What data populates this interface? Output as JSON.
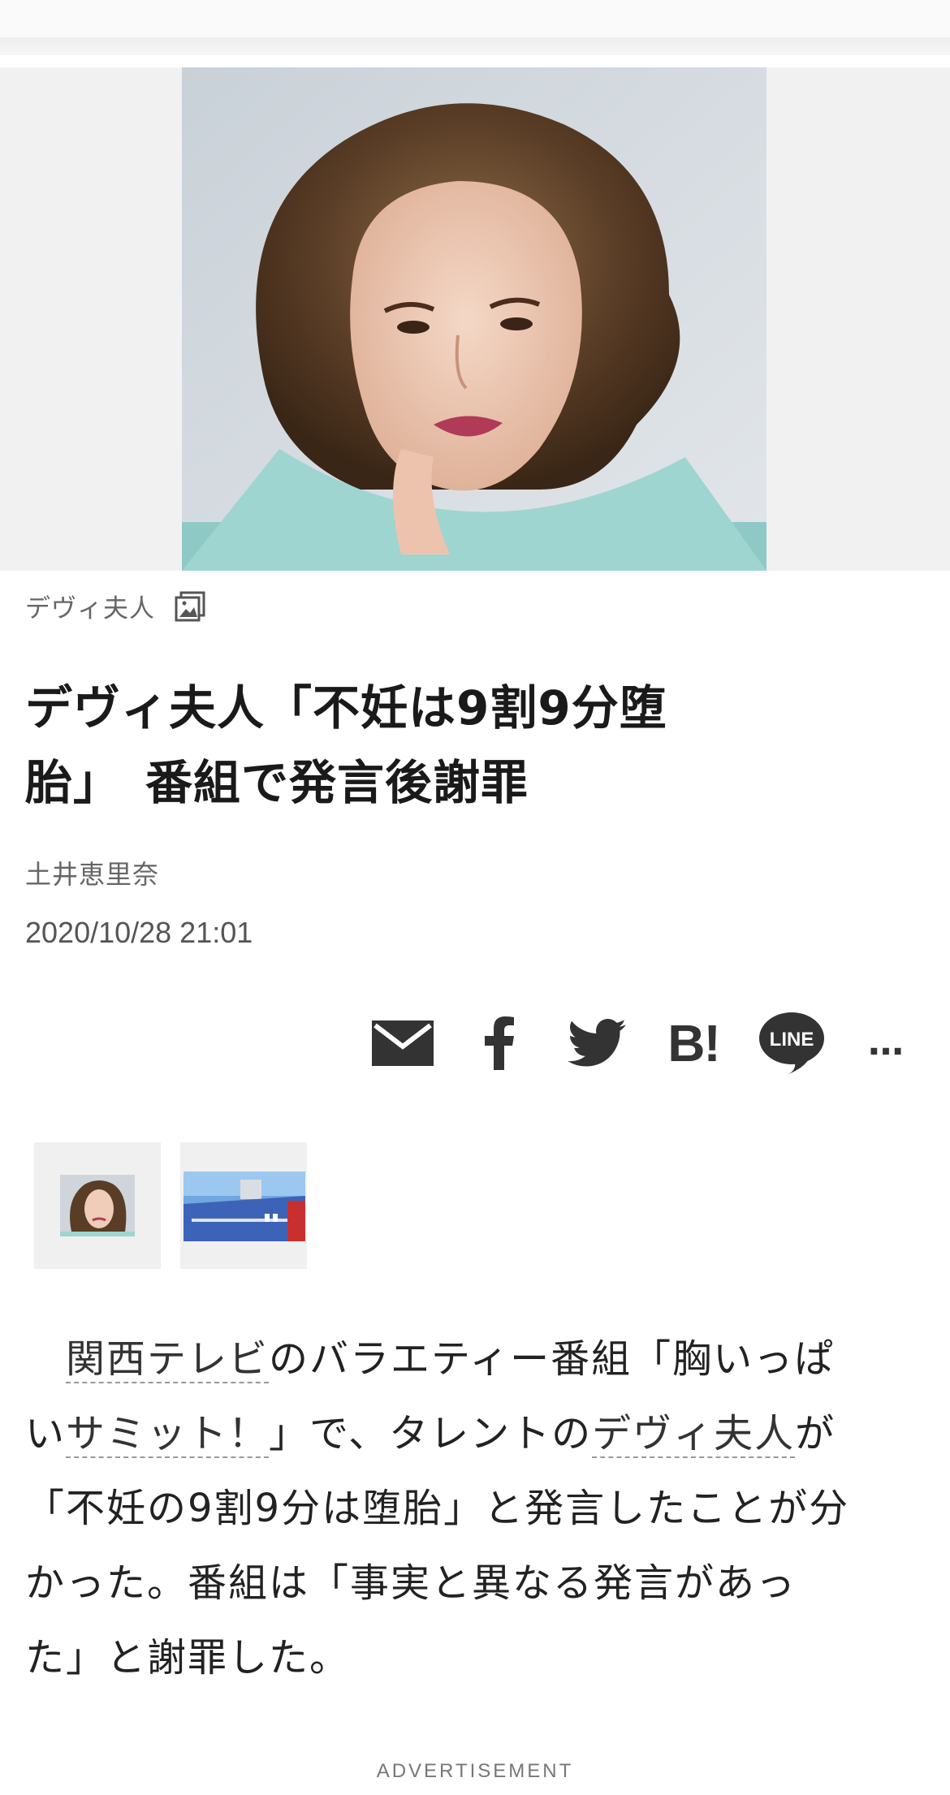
{
  "article": {
    "topic": "デヴィ夫人",
    "headline_line1": "デヴィ夫人「不妊は9割9分堕",
    "headline_line2": "胎」　番組で発言後謝罪",
    "author": "土井恵里奈",
    "datetime": "2020/10/28 21:01"
  },
  "share": {
    "line_label": "LINE",
    "hatena_label": "B!",
    "more_label": "…"
  },
  "body": {
    "indent": "　",
    "link1": "関西テレビ",
    "text1": "のバラエティー番組「胸いっぱ",
    "text2": "い",
    "link2": "サミット！",
    "text3": "」で、タレントの",
    "link3": "デヴィ夫人",
    "text4": "が",
    "line3": "「不妊の9割9分は堕胎」と発言したことが分",
    "line4": "かった。番組は「事実と異なる発言があっ",
    "line5": "た」と謝罪した。"
  },
  "ad_label": "ADVERTISEMENT",
  "icons": [
    "gallery-icon",
    "mail-icon",
    "facebook-icon",
    "twitter-icon",
    "hatena-bookmark-icon",
    "line-icon",
    "more-icon"
  ],
  "colors": {
    "icon": "#333333",
    "meta_text": "#666666",
    "link_underline": "#999999"
  }
}
